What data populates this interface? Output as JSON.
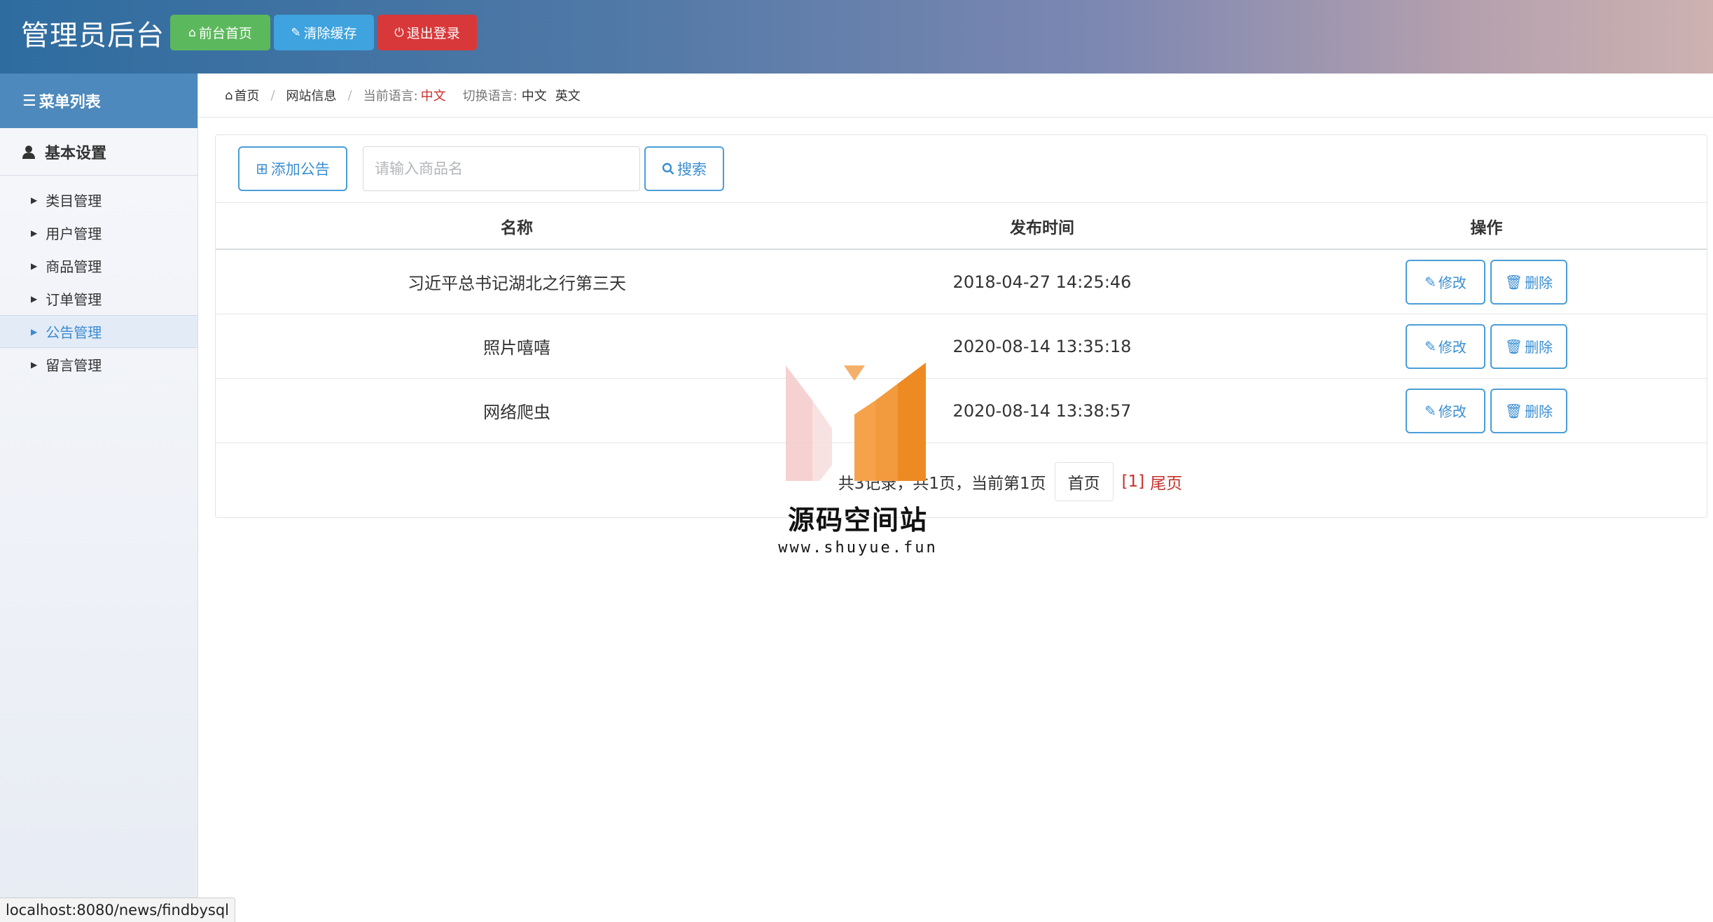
{
  "header": {
    "title": "管理员后台",
    "buttons": {
      "home": "前台首页",
      "clear_cache": "清除缓存",
      "logout": "退出登录"
    }
  },
  "sidebar": {
    "header": "菜单列表",
    "group": "基本设置",
    "items": [
      {
        "label": "类目管理"
      },
      {
        "label": "用户管理"
      },
      {
        "label": "商品管理"
      },
      {
        "label": "订单管理"
      },
      {
        "label": "公告管理",
        "active": true
      },
      {
        "label": "留言管理"
      }
    ]
  },
  "breadcrumb": {
    "home": "首页",
    "site_info": "网站信息",
    "current_lang_label": "当前语言:",
    "current_lang": "中文",
    "switch_lang_label": "切换语言:",
    "lang_zh": "中文",
    "lang_en": "英文"
  },
  "toolbar": {
    "add_label": "添加公告",
    "search_placeholder": "请输入商品名",
    "search_label": "搜索"
  },
  "table": {
    "columns": [
      "名称",
      "发布时间",
      "操作"
    ],
    "rows": [
      {
        "name": "习近平总书记湖北之行第三天",
        "time": "2018-04-27 14:25:46"
      },
      {
        "name": "照片嘻嘻",
        "time": "2020-08-14 13:35:18"
      },
      {
        "name": "网络爬虫",
        "time": "2020-08-14 13:38:57"
      }
    ],
    "edit_label": "修改",
    "delete_label": "删除"
  },
  "pagination": {
    "summary": "共3记录，共1页，当前第1页",
    "first": "首页",
    "page": "[1]",
    "last": "尾页"
  },
  "watermark": {
    "name": "源码空间站",
    "url": "www.shuyue.fun"
  },
  "status_bar": {
    "url": "localhost:8080/news/findbysql"
  },
  "colors": {
    "home_btn": "#5cb85c",
    "cache_btn": "#3ea3de",
    "logout_btn": "#d9383a",
    "accent_blue": "#3a8ed0",
    "accent_red": "#c7302b"
  }
}
